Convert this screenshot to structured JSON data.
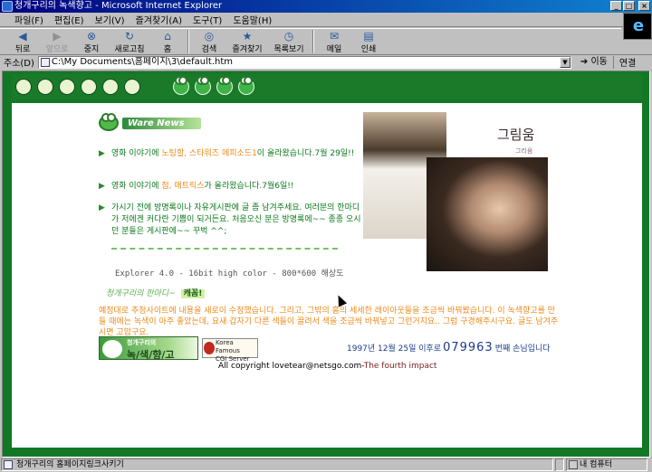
{
  "window": {
    "title": "청개구리의 녹색향고 - Microsoft Internet Explorer"
  },
  "menu": [
    "파일(F)",
    "편집(E)",
    "보기(V)",
    "즐겨찾기(A)",
    "도구(T)",
    "도움말(H)"
  ],
  "toolbar": {
    "back": "뒤로",
    "forward": "앞으로",
    "stop": "중지",
    "refresh": "새로고침",
    "home": "홈",
    "search": "검색",
    "favorites": "즐겨찾기",
    "history": "목록보기",
    "mail": "메일",
    "print": "인쇄"
  },
  "address": {
    "label": "주소(D)",
    "url": "C:\\My Documents\\홈페이지\\3\\default.htm",
    "go": "이동",
    "links": "연결"
  },
  "site": {
    "nav": [
      "",
      "",
      "",
      "",
      "",
      ""
    ],
    "ware_news": "Ware News",
    "news": [
      {
        "a": "영화 이야기에 ",
        "b": "노팅할, 스타워즈 에피소드1",
        "c": "이 올라왔습니다.7월 29일!!"
      },
      {
        "a": "영화 이야기에 ",
        "b": "첨, 매트릭스",
        "c": "가 올라왔습니다.7월6일!!"
      },
      {
        "a": "가시기 전에 방명록이나 자유게시판에 글 좀 남겨주세요. 여러분의 한마디가 저에겐 커다란 기쁨이 되거든요. 처음오신 분은 방명록에~~ 종종 오시던 분들은 게시판에~~ 꾸벅 ^^;",
        "b": "",
        "c": ""
      }
    ],
    "explorer": "Explorer 4.0 - 16bit high color - 800*600 해상도",
    "photo_title": "그림움",
    "photo_sub": "그리움",
    "sig_a": "청개구리의 한마디~",
    "sig_b": "캐꼼!",
    "paragraph": "예정대로 추청사이트에 내용을 새로이 수정했습니다. 그리고, 그밖의 홈의 세세한 레이아웃들을 조금씩 바꿔봤습니다. 이 녹색향고를 만들 때에는 녹색이 아주 좋았는데, 요새 갑자기 다른 색들이 끌려서 색을 조금씩 바꿔넣고 그런거지요.. 그럼 구경해주시구요. 글도 남겨주시면 고맙구요.",
    "banner1_top": "청개구리의",
    "banner1_main": "녹/색/향/고",
    "banner2_l1": "Korea Famous",
    "banner2_l2": "CGI Server",
    "visitor_pre": "1997년 12월 25일 이후로",
    "visitor_count": "079963",
    "visitor_post": "번째 손님입니다",
    "copyright_1": "All copyright lovetear@netsgo.com-",
    "copyright_2": "The fourth impact"
  },
  "status": {
    "text": "청개구리의 홈페이지링크사키기",
    "zone": "내 컴퓨터"
  }
}
